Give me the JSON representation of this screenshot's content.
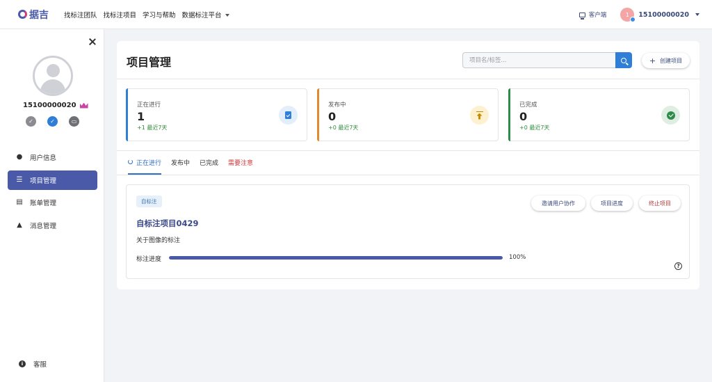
{
  "header": {
    "logo_text": "据吉",
    "nav": [
      "找标注团队",
      "找标注项目",
      "学习与帮助",
      "数据标注平台"
    ],
    "client_link": "客户端",
    "avatar_initial": "1",
    "username": "15100000020"
  },
  "sidebar": {
    "username": "15100000020",
    "menu": [
      {
        "label": "用户信息",
        "icon": "user-icon"
      },
      {
        "label": "项目管理",
        "icon": "list-icon",
        "active": true
      },
      {
        "label": "账单管理",
        "icon": "bill-icon"
      },
      {
        "label": "消息管理",
        "icon": "bell-icon"
      }
    ],
    "service_label": "客服"
  },
  "main": {
    "title": "项目管理",
    "search_placeholder": "项目名/标签...",
    "create_label": "创建项目",
    "stats": [
      {
        "label": "正在进行",
        "value": "1",
        "delta": "+1 最近7天",
        "color": "#2f7ed8"
      },
      {
        "label": "发布中",
        "value": "0",
        "delta": "+0 最近7天",
        "color": "#e08a2e"
      },
      {
        "label": "已完成",
        "value": "0",
        "delta": "+0 最近7天",
        "color": "#2e8b4a"
      }
    ],
    "tabs": [
      "正在进行",
      "发布中",
      "已完成",
      "需要注意"
    ],
    "project": {
      "tag": "自标注",
      "actions": [
        "邀请用户协作",
        "项目进度",
        "终止项目"
      ],
      "name": "自标注项目0429",
      "description": "关于图像的标注",
      "progress_label": "标注进度",
      "progress_value": 1.0,
      "progress_text": "100%"
    }
  },
  "colors": {
    "brand": "#4a5aa8",
    "accent_blue": "#2f7ed8",
    "warn_red": "#d23c3c"
  }
}
